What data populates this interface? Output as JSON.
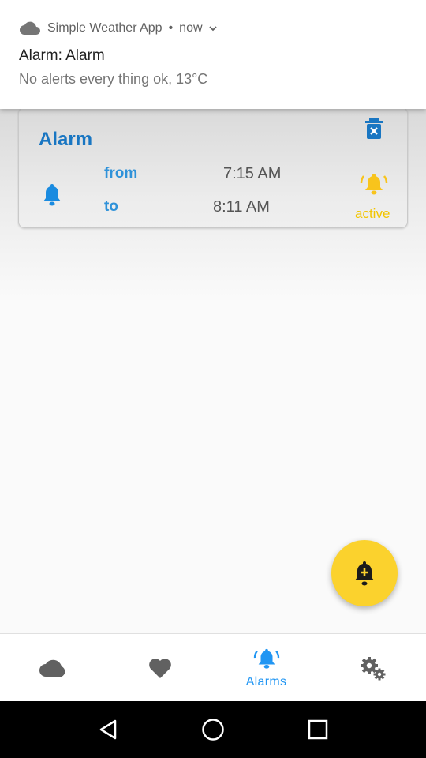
{
  "notification": {
    "app_name": "Simple Weather App",
    "separator": "•",
    "time": "now",
    "title": "Alarm: Alarm",
    "text": "No alerts every thing ok, 13°C"
  },
  "alarm_card": {
    "title": "Alarm",
    "from_label": "from",
    "to_label": "to",
    "from_time": "7:15 AM",
    "to_time": "8:11 AM",
    "status": "active"
  },
  "bottom_nav": {
    "items": [
      {
        "icon": "cloud-icon",
        "label": "",
        "active": false
      },
      {
        "icon": "heart-icon",
        "label": "",
        "active": false
      },
      {
        "icon": "alarm-bell-icon",
        "label": "Alarms",
        "active": true
      },
      {
        "icon": "settings-gears-icon",
        "label": "",
        "active": false
      }
    ]
  },
  "system_nav": {
    "icons": [
      "back-icon",
      "home-icon",
      "recents-icon"
    ]
  },
  "colors": {
    "primary_blue": "#1976c2",
    "accent_blue": "#2196f3",
    "accent_yellow": "#fbd22d",
    "icon_gray": "#616161"
  }
}
